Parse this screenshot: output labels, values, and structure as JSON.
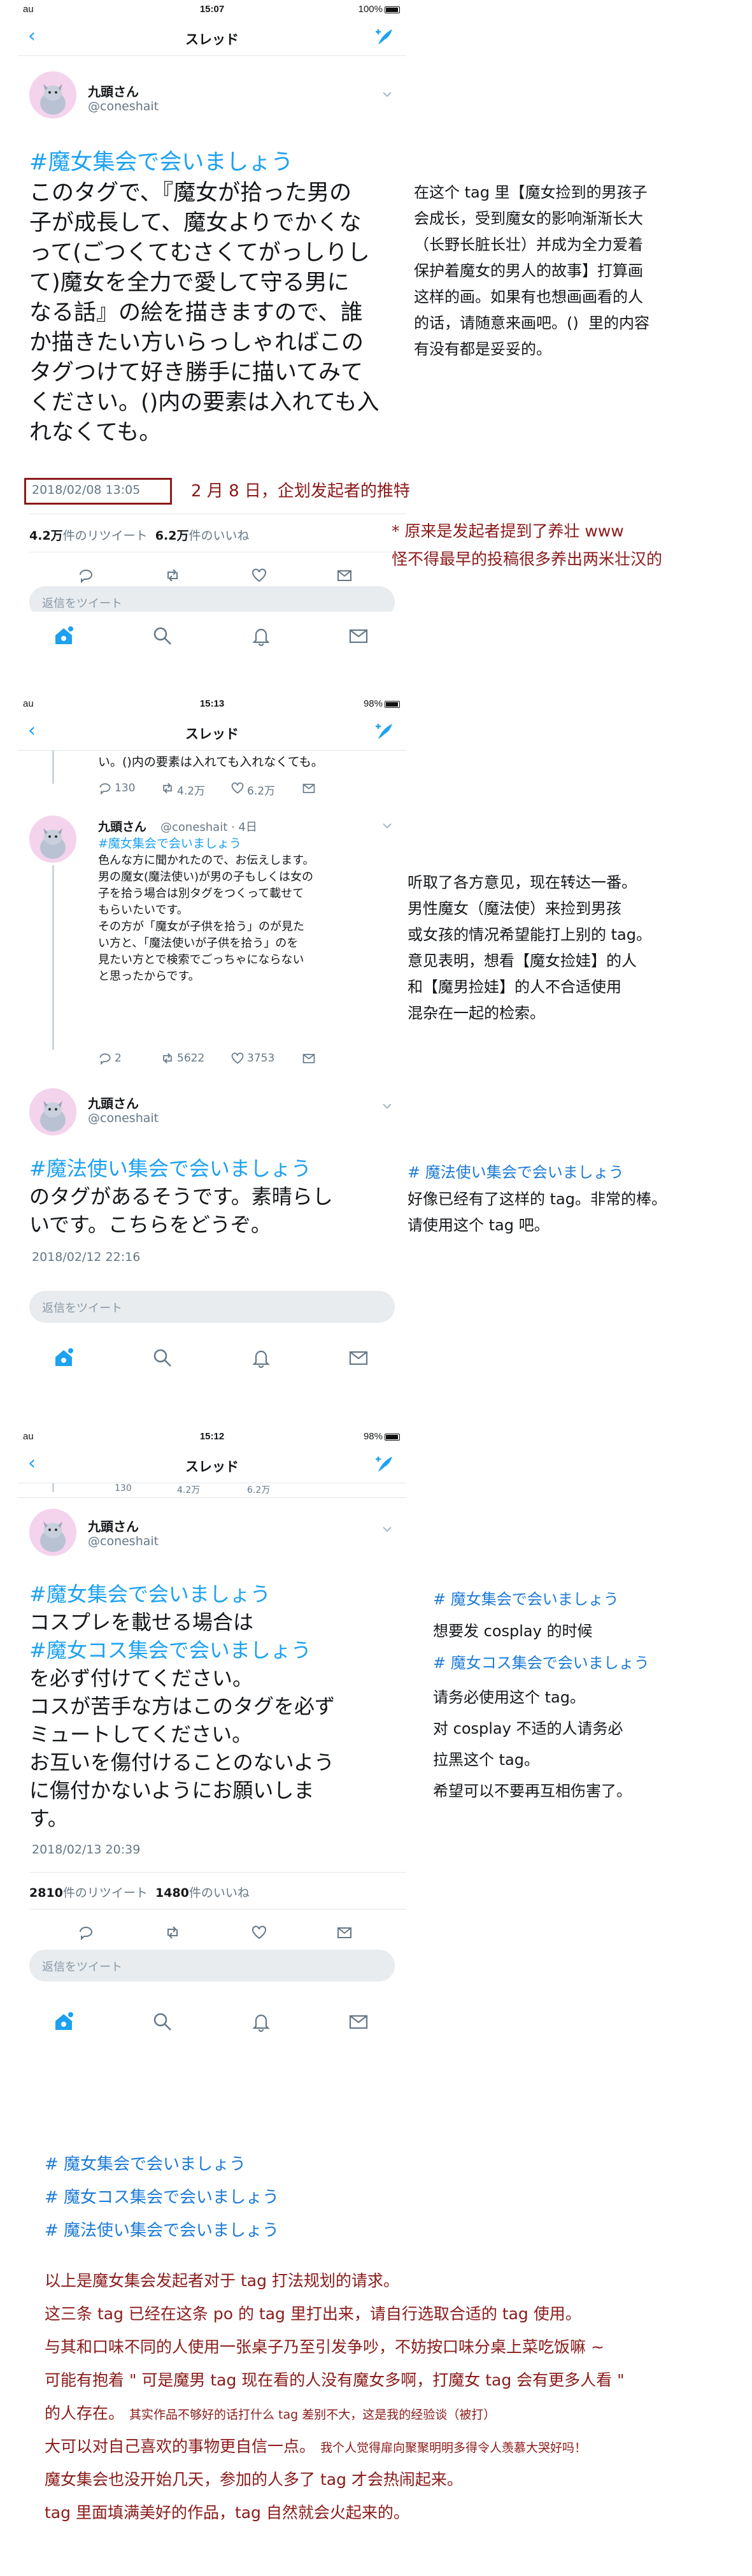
{
  "phone1": {
    "status": {
      "carrier": "au",
      "time": "15:07",
      "battery": "100%"
    },
    "nav": {
      "back": "<",
      "title": "スレッド"
    },
    "tweet": {
      "name": "九頭さん",
      "handle": "@coneshait",
      "hashtag": "#魔女集会で会いましょう",
      "body": "このタグで、『魔女が拾った男の\n子が成長して、魔女よりでかくな\nって(ごつくてむさくてがっしりし\nて)魔女を全力で愛して守る男に\nなる話』の絵を描きますので、誰\nか描きたい方いらっしゃればこの\nタグつけて好き勝手に描いてみて\nください。()内の要素は入れても入\nれなくても。",
      "timestamp": "2018/02/08 13:05",
      "retweets": "4.2万",
      "retweets_label": "件のリツイート",
      "likes": "6.2万",
      "likes_label": "件のいいね"
    },
    "reply_placeholder": "返信をツイート"
  },
  "phone2": {
    "status": {
      "carrier": "au",
      "time": "15:13",
      "battery": "98%"
    },
    "nav": {
      "back": "<",
      "title": "スレッド"
    },
    "prev_tweet": {
      "text": "い。()内の要素は入れても入れなくても。",
      "replies": "130",
      "retweets": "4.2万",
      "likes": "6.2万"
    },
    "mid_tweet": {
      "name": "九頭さん",
      "handle": "@coneshait · 4日",
      "hashtag": "#魔女集会で会いましょう",
      "body": "色んな方に聞かれたので、お伝えします。\n男の魔女(魔法使い)が男の子もしくは女の\n子を拾う場合は別タグをつくって載せて\nもらいたいです。\nその方が「魔女が子供を拾う」のが見た\nい方と、「魔法使いが子供を拾う」のを\n見たい方とで検索でごっちゃにならない\nと思ったからです。",
      "replies": "2",
      "retweets": "5622",
      "likes": "3753"
    },
    "tweet": {
      "name": "九頭さん",
      "handle": "@coneshait",
      "hashtag": "#魔法使い集会で会いましょう",
      "body": "のタグがあるそうです。素晴らし\nいです。こちらをどうぞ。",
      "timestamp": "2018/02/12 22:16"
    },
    "reply_placeholder": "返信をツイート"
  },
  "phone3": {
    "status": {
      "carrier": "au",
      "time": "15:12",
      "battery": "98%"
    },
    "nav": {
      "back": "<",
      "title": "スレッド"
    },
    "prev_tweet": {
      "replies": "130",
      "retweets": "4.2万",
      "likes": "6.2万"
    },
    "tweet": {
      "name": "九頭さん",
      "handle": "@coneshait",
      "hashtag1": "#魔女集会で会いましょう",
      "line2": "コスプレを載せる場合は",
      "hashtag2": "#魔女コス集会で会いましょう",
      "body": "を必ず付けてください。\nコスが苦手な方はこのタグを必ず\nミュートしてください。\nお互いを傷付けることのないよう\nに傷付かないようにお願いしま\nす。",
      "timestamp": "2018/02/13 20:39",
      "retweets": "2810",
      "retweets_label": "件のリツイート",
      "likes": "1480",
      "likes_label": "件のいいね"
    },
    "reply_placeholder": "返信をツイート"
  },
  "annotations": {
    "note1": "在这个 tag 里【魔女捡到的男孩子\n会成长，受到魔女的影响渐渐长大\n（长野长脏长壮）并成为全力爱着\n保护着魔女的男人的故事】打算画\n这样的画。如果有也想画画看的人\n的话，请随意来画吧。()  里的内容\n有没有都是妥妥的。",
    "note_date": "2 月 8 日，企划发起者的推特",
    "note_red": "* 原来是发起者提到了养壮 www\n怪不得最早的投稿很多养出两米壮汉的",
    "note2": "听取了各方意见，现在转达一番。\n男性魔女（魔法使）来捡到男孩\n或女孩的情况希望能打上别的 tag。\n意见表明，想看【魔女捡娃】的人\n和【魔男捡娃】的人不合适使用\n混杂在一起的检索。",
    "note3_tag": "# 魔法使い集会で会いましょう",
    "note3": "好像已经有了这样的 tag。非常的棒。\n请使用这个 tag 吧。",
    "note4_tag1": "# 魔女集会で会いましょう",
    "note4_line2": "想要发 cosplay 的时候",
    "note4_tag2": "# 魔女コス集会で会いましょう",
    "note4_body": "请务必使用这个 tag。\n对 cosplay 不适的人请务必\n拉黑这个 tag。\n希望可以不要再互相伤害了。"
  },
  "summary": {
    "tag1": "# 魔女集会で会いましょう",
    "tag2": "# 魔女コス集会で会いましょう",
    "tag3": "# 魔法使い集会で会いましょう",
    "l1": "以上是魔女集会发起者对于 tag 打法规划的请求。",
    "l2": "这三条 tag 已经在这条 po 的 tag 里打出来，请自行选取合适的 tag 使用。",
    "l3": "与其和口味不同的人使用一张桌子乃至引发争吵，不妨按口味分桌上菜吃饭嘛 ~",
    "l4": "可能有抱着 \" 可是魔男 tag 现在看的人没有魔女多啊，打魔女 tag 会有更多人看 \"",
    "l5a": "的人存在。",
    "l5b": "其实作品不够好的话打什么 tag 差别不大，这是我的经验谈（被打）",
    "l6a": "大可以对自己喜欢的事物更自信一点。",
    "l6b": "我个人觉得扉向聚聚明明多得令人羡慕大哭好吗！",
    "l7": "魔女集会也没开始几天，参加的人多了 tag 才会热闹起来。",
    "l8": "tag 里面填满美好的作品，tag 自然就会火起来的。"
  }
}
